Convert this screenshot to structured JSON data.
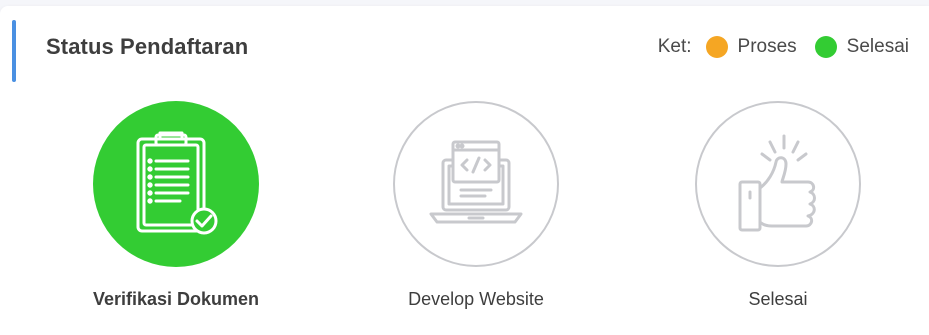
{
  "header": {
    "title": "Status Pendaftaran"
  },
  "legend": {
    "label": "Ket:",
    "items": [
      {
        "label": "Proses",
        "color": "#f5a623"
      },
      {
        "label": "Selesai",
        "color": "#33cc33"
      }
    ]
  },
  "steps": [
    {
      "label": "Verifikasi Dokumen",
      "icon": "clipboard-check-icon",
      "status": "done"
    },
    {
      "label": "Develop Website",
      "icon": "laptop-code-icon",
      "status": "pending"
    },
    {
      "label": "Selesai",
      "icon": "thumbs-up-icon",
      "status": "pending"
    }
  ],
  "colors": {
    "accent": "#4a90e2",
    "done": "#33cc33",
    "pending_outline": "#c8c9cd"
  }
}
